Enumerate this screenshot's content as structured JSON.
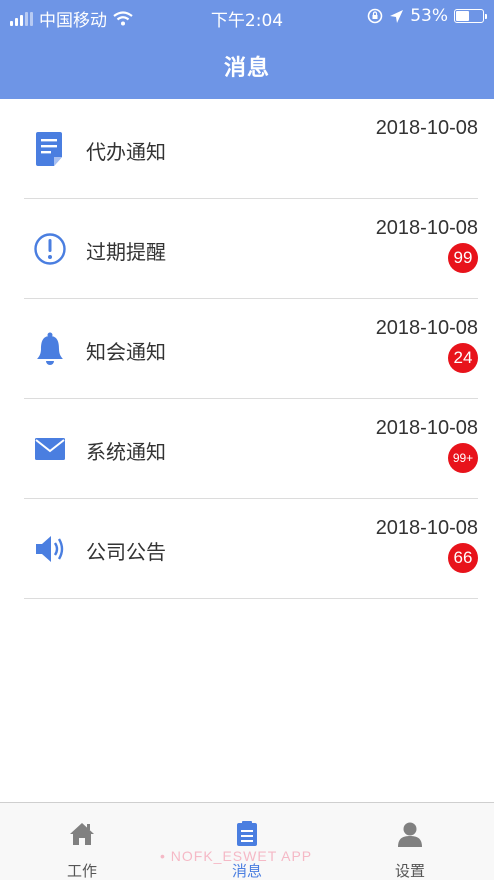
{
  "colors": {
    "accent": "#6e95e6",
    "badge": "#e8131b",
    "icon": "#4a7ee0"
  },
  "status_bar": {
    "carrier": "中国移动",
    "time": "下午2:04",
    "battery": "53%",
    "battery_level": 0.53
  },
  "header": {
    "title": "消息"
  },
  "messages": [
    {
      "label": "代办通知",
      "date": "2018-10-08",
      "badge": "",
      "icon": "document-icon"
    },
    {
      "label": "过期提醒",
      "date": "2018-10-08",
      "badge": "99",
      "icon": "exclamation-circle-icon"
    },
    {
      "label": "知会通知",
      "date": "2018-10-08",
      "badge": "24",
      "icon": "bell-icon"
    },
    {
      "label": "系统通知",
      "date": "2018-10-08",
      "badge": "99+",
      "icon": "envelope-icon"
    },
    {
      "label": "公司公告",
      "date": "2018-10-08",
      "badge": "66",
      "icon": "speaker-icon"
    }
  ],
  "tabs": [
    {
      "label": "工作",
      "icon": "home-icon",
      "active": false
    },
    {
      "label": "消息",
      "icon": "clipboard-icon",
      "active": true
    },
    {
      "label": "设置",
      "icon": "user-icon",
      "active": false
    }
  ],
  "watermark": "• NOFK_ESWET APP"
}
